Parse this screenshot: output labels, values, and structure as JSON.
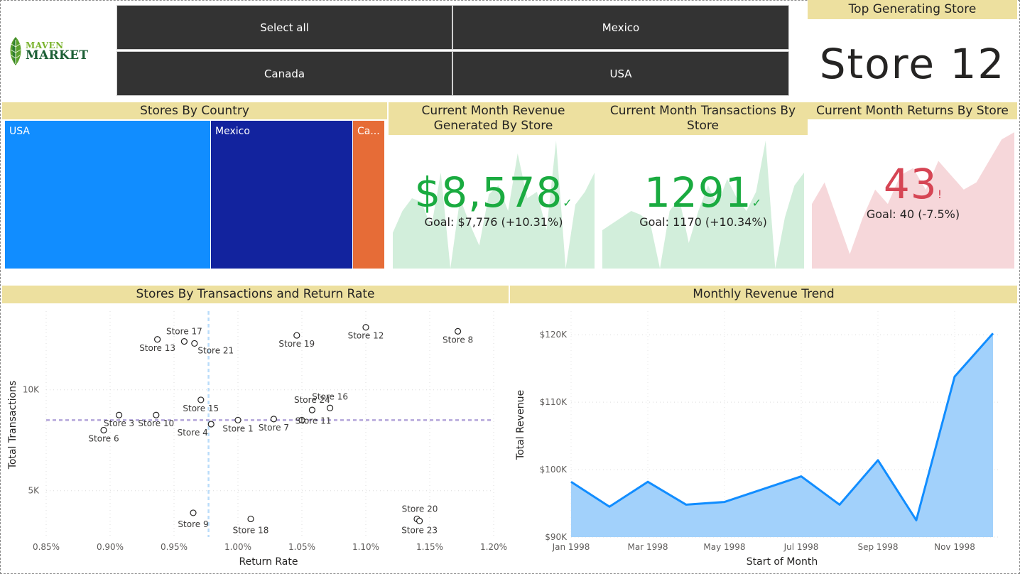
{
  "logo": {
    "line1": "MAVEN",
    "line2": "MARKET"
  },
  "slicer": {
    "buttons": [
      "Select all",
      "Mexico",
      "Canada",
      "USA"
    ]
  },
  "top_store": {
    "title": "Top Generating Store",
    "value": "Store 12"
  },
  "colors": {
    "header_bg": "#ede09f",
    "usa": "#118dff",
    "mexico": "#12239e",
    "canada": "#e66c37",
    "kpi_good": "#1aab40",
    "kpi_bad": "#d64554",
    "area_good": "#d2eedb",
    "area_bad": "#f6d7da",
    "line": "#118dff",
    "area_fill": "#a2d1fb"
  },
  "treemap": {
    "title": "Stores By Country",
    "tiles": [
      {
        "label": "USA",
        "share": 0.544
      },
      {
        "label": "Mexico",
        "share": 0.375
      },
      {
        "label": "Ca...",
        "share": 0.081
      }
    ]
  },
  "kpis": [
    {
      "title": "Current Month Revenue Generated By Store",
      "value": "$8,578",
      "indicator": "✓",
      "goal": "Goal: $7,776 (+10.31%)",
      "status": "good",
      "trend": [
        0.28,
        0.45,
        0.55,
        0.52,
        0.32,
        0.75,
        0.0,
        0.55,
        0.35,
        0.18,
        0.58,
        0.65,
        0.45,
        0.9,
        0.55,
        0.6,
        0.3,
        1.0,
        0.0,
        0.5,
        0.6,
        0.75
      ]
    },
    {
      "title": "Current Month Transactions By Store",
      "value": "1291",
      "indicator": "✓",
      "goal": "Goal: 1170 (+10.34%)",
      "status": "good",
      "trend": [
        0.3,
        0.35,
        0.4,
        0.45,
        0.42,
        0.35,
        0.0,
        0.45,
        0.55,
        0.2,
        0.45,
        0.65,
        0.5,
        0.7,
        0.55,
        0.45,
        0.6,
        1.0,
        0.0,
        0.4,
        0.65,
        0.75
      ]
    },
    {
      "title": "Current Month Returns By Store",
      "value": "43",
      "indicator": "!",
      "goal": "Goal: 40 (-7.5%)",
      "status": "bad",
      "trend": [
        0.45,
        0.6,
        0.35,
        0.1,
        0.35,
        0.55,
        0.45,
        0.65,
        0.7,
        0.55,
        0.75,
        0.65,
        0.55,
        0.6,
        0.75,
        0.9,
        0.95
      ]
    }
  ],
  "chart_data": [
    {
      "type": "scatter",
      "title": "Stores By Transactions and Return Rate",
      "xlabel": "Return Rate",
      "ylabel": "Total Transactions",
      "xlim": [
        0.0085,
        0.012
      ],
      "ylim": [
        2700,
        13900
      ],
      "xticks": [
        0.0085,
        0.009,
        0.0095,
        0.01,
        0.0105,
        0.011,
        0.0115,
        0.012
      ],
      "xtick_labels": [
        "0.85%",
        "0.90%",
        "0.95%",
        "1.00%",
        "1.05%",
        "1.10%",
        "1.15%",
        "1.20%"
      ],
      "yticks": [
        5000,
        10000
      ],
      "ytick_labels": [
        "5K",
        "10K"
      ],
      "reference_lines": {
        "x_average": 0.00977,
        "y_average": 8500
      },
      "grid": true,
      "points": [
        {
          "label": "Store 1",
          "x": 0.01,
          "y": 8500
        },
        {
          "label": "Store 3",
          "x": 0.00907,
          "y": 8750
        },
        {
          "label": "Store 4",
          "x": 0.00979,
          "y": 8300
        },
        {
          "label": "Store 6",
          "x": 0.00895,
          "y": 8000
        },
        {
          "label": "Store 7",
          "x": 0.01028,
          "y": 8550
        },
        {
          "label": "Store 8",
          "x": 0.01172,
          "y": 12900
        },
        {
          "label": "Store 9",
          "x": 0.00965,
          "y": 3900
        },
        {
          "label": "Store 10",
          "x": 0.00936,
          "y": 8750
        },
        {
          "label": "Store 11",
          "x": 0.0105,
          "y": 8500
        },
        {
          "label": "Store 12",
          "x": 0.011,
          "y": 13100
        },
        {
          "label": "Store 13",
          "x": 0.00937,
          "y": 12500
        },
        {
          "label": "Store 15",
          "x": 0.00971,
          "y": 9500
        },
        {
          "label": "Store 16",
          "x": 0.01072,
          "y": 9100
        },
        {
          "label": "Store 17",
          "x": 0.00958,
          "y": 12400
        },
        {
          "label": "Store 18",
          "x": 0.0101,
          "y": 3600
        },
        {
          "label": "Store 19",
          "x": 0.01046,
          "y": 12700
        },
        {
          "label": "Store 20",
          "x": 0.0114,
          "y": 3600
        },
        {
          "label": "Store 21",
          "x": 0.00966,
          "y": 12300
        },
        {
          "label": "Store 23",
          "x": 0.01142,
          "y": 3500
        },
        {
          "label": "Store 24",
          "x": 0.01058,
          "y": 9000
        }
      ]
    },
    {
      "type": "area",
      "title": "Monthly Revenue Trend",
      "xlabel": "Start of Month",
      "ylabel": "Total Revenue",
      "x": [
        "Jan 1998",
        "Feb 1998",
        "Mar 1998",
        "Apr 1998",
        "May 1998",
        "Jun 1998",
        "Jul 1998",
        "Aug 1998",
        "Sep 1998",
        "Oct 1998",
        "Nov 1998",
        "Dec 1998"
      ],
      "xtick_labels": [
        "Jan 1998",
        "Mar 1998",
        "May 1998",
        "Jul 1998",
        "Sep 1998",
        "Nov 1998"
      ],
      "values": [
        98200,
        94500,
        98200,
        94800,
        95200,
        97100,
        99000,
        94800,
        101400,
        92500,
        113800,
        120200
      ],
      "ylim": [
        90000,
        123500
      ],
      "yticks": [
        90000,
        100000,
        110000,
        120000
      ],
      "ytick_labels": [
        "$90K",
        "$100K",
        "$110K",
        "$120K"
      ],
      "grid": true
    }
  ]
}
